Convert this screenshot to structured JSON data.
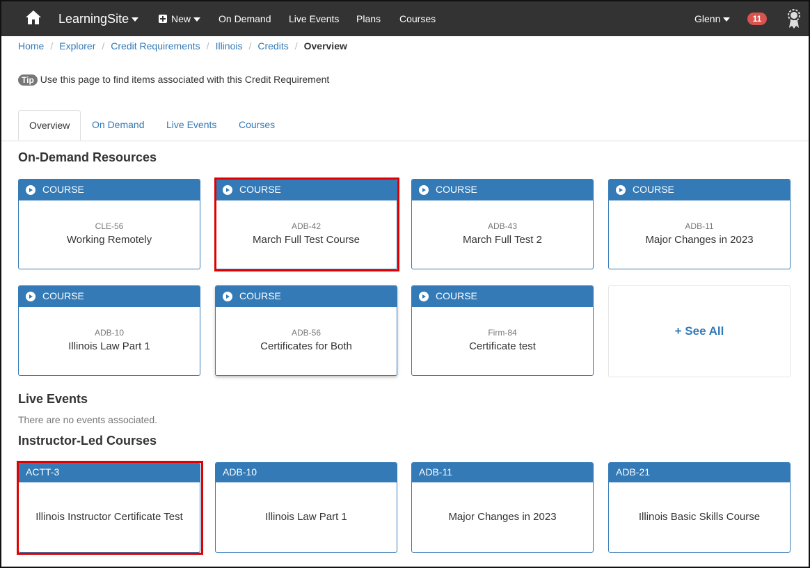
{
  "navbar": {
    "brand": "LearningSite",
    "new_label": "New",
    "links": [
      "On Demand",
      "Live Events",
      "Plans",
      "Courses"
    ],
    "user": "Glenn",
    "notification_count": "11",
    "icons": {
      "home": "home-icon",
      "new": "plus-square-icon",
      "award": "award-icon"
    }
  },
  "breadcrumb": {
    "items": [
      "Home",
      "Explorer",
      "Credit Requirements",
      "Illinois",
      "Credits"
    ],
    "active": "Overview"
  },
  "tip": {
    "label": "Tip",
    "text": "Use this page to find items associated with this Credit Requirement"
  },
  "tabs": [
    "Overview",
    "On Demand",
    "Live Events",
    "Courses"
  ],
  "on_demand": {
    "title": "On-Demand Resources",
    "cards": [
      {
        "type": "COURSE",
        "code": "CLE-56",
        "title": "Working Remotely"
      },
      {
        "type": "COURSE",
        "code": "ADB-42",
        "title": "March Full Test Course"
      },
      {
        "type": "COURSE",
        "code": "ADB-43",
        "title": "March Full Test 2"
      },
      {
        "type": "COURSE",
        "code": "ADB-11",
        "title": "Major Changes in 2023"
      },
      {
        "type": "COURSE",
        "code": "ADB-10",
        "title": "Illinois Law Part 1"
      },
      {
        "type": "COURSE",
        "code": "ADB-56",
        "title": "Certificates for Both"
      },
      {
        "type": "COURSE",
        "code": "Firm-84",
        "title": "Certificate test"
      }
    ],
    "see_all": "See All"
  },
  "live_events": {
    "title": "Live Events",
    "empty_text": "There are no events associated."
  },
  "instructor_led": {
    "title": "Instructor-Led Courses",
    "cards": [
      {
        "code": "ACTT-3",
        "title": "Illinois Instructor Certificate Test"
      },
      {
        "code": "ADB-10",
        "title": "Illinois Law Part 1"
      },
      {
        "code": "ADB-11",
        "title": "Major Changes in 2023"
      },
      {
        "code": "ADB-21",
        "title": "Illinois Basic Skills Course"
      }
    ]
  },
  "colors": {
    "primary": "#337ab7",
    "navbar": "#333333",
    "highlight": "#e00000",
    "badge": "#d9534f"
  }
}
